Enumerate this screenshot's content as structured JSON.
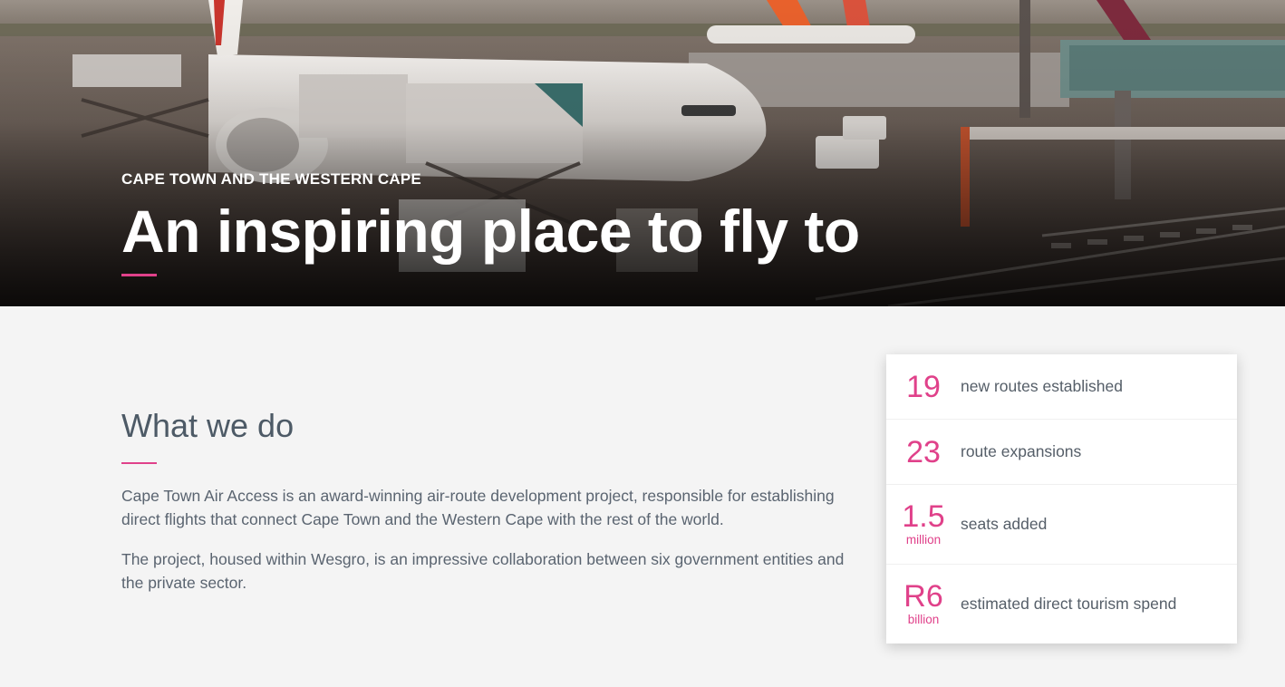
{
  "hero": {
    "eyebrow": "CAPE TOWN AND THE WESTERN CAPE",
    "title": "An inspiring place to fly to",
    "accent_color": "#e0418a"
  },
  "what_we_do": {
    "title": "What we do",
    "paragraphs": [
      "Cape Town Air Access is an award-winning air-route development project, responsible for establishing direct flights that connect Cape Town and the Western Cape with the rest of the world.",
      "The project, housed within Wesgro, is an impressive collaboration between six government entities and the private sector."
    ]
  },
  "stats": [
    {
      "value": "19",
      "unit": "",
      "label": "new routes established"
    },
    {
      "value": "23",
      "unit": "",
      "label": "route expansions"
    },
    {
      "value": "1.5",
      "unit": "million",
      "label": "seats added"
    },
    {
      "value": "R6",
      "unit": "billion",
      "label": "estimated direct tourism spend"
    }
  ],
  "colors": {
    "accent": "#e0418a",
    "page_bg": "#f4f4f4",
    "card_bg": "#ffffff"
  }
}
